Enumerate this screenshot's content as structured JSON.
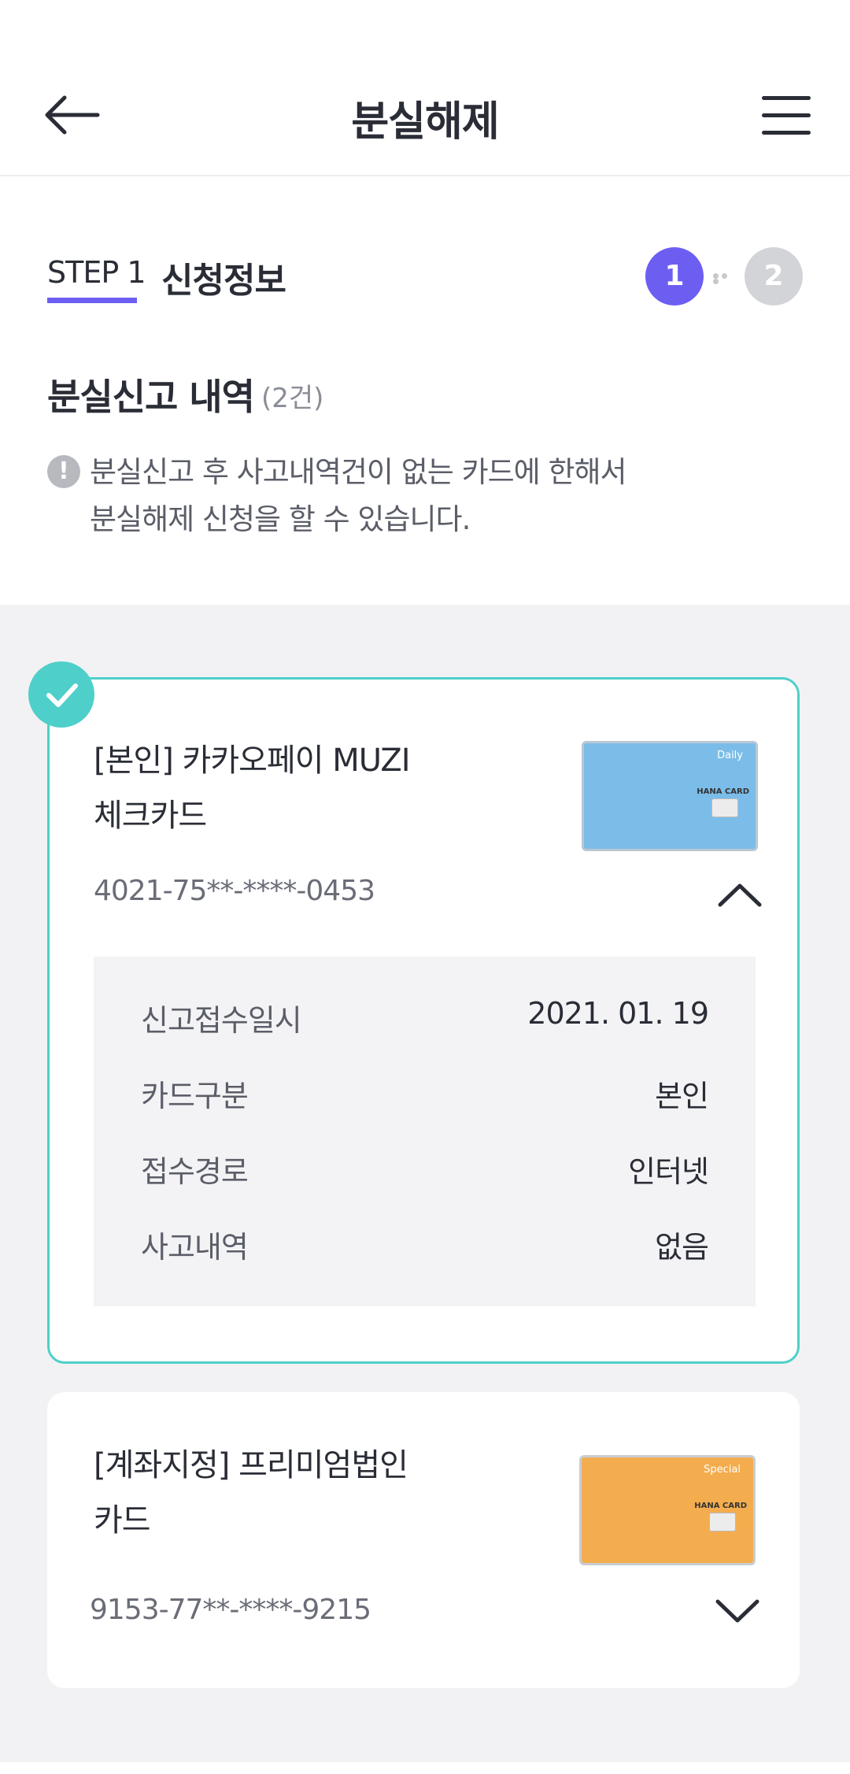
{
  "header": {
    "title": "분실해제",
    "back_icon": "arrow-left-icon",
    "menu_icon": "hamburger-menu-icon"
  },
  "step": {
    "label": "STEP 1",
    "name": "신청정보",
    "current": "1",
    "next": "2"
  },
  "section": {
    "title": "분실신고 내역",
    "count": "(2건)",
    "notice_line1": "분실신고 후 사고내역건이 없는 카드에 한해서",
    "notice_line2": "분실해제 신청을 할 수 있습니다."
  },
  "cards": [
    {
      "name_line1": "[본인] 카카오페이 MUZI",
      "name_line2": "체크카드",
      "number": "4021-75**-****-0453",
      "image_color": "#7bbde8",
      "brand": "Daily",
      "issuer": "HANA CARD",
      "selected": true,
      "expanded": true,
      "details": [
        {
          "label": "신고접수일시",
          "value": "2021. 01. 19"
        },
        {
          "label": "카드구분",
          "value": "본인"
        },
        {
          "label": "접수경로",
          "value": "인터넷"
        },
        {
          "label": "사고내역",
          "value": "없음"
        }
      ]
    },
    {
      "name_line1": "[계좌지정] 프리미엄법인",
      "name_line2": "카드",
      "number": "9153-77**-****-9215",
      "image_color": "#f3ad4e",
      "brand": "Special",
      "issuer": "HANA CARD",
      "selected": false,
      "expanded": false
    }
  ],
  "colors": {
    "accent": "#6d5ef2",
    "selected_border": "#4fcfc9",
    "step_inactive": "#d3d4d8"
  }
}
